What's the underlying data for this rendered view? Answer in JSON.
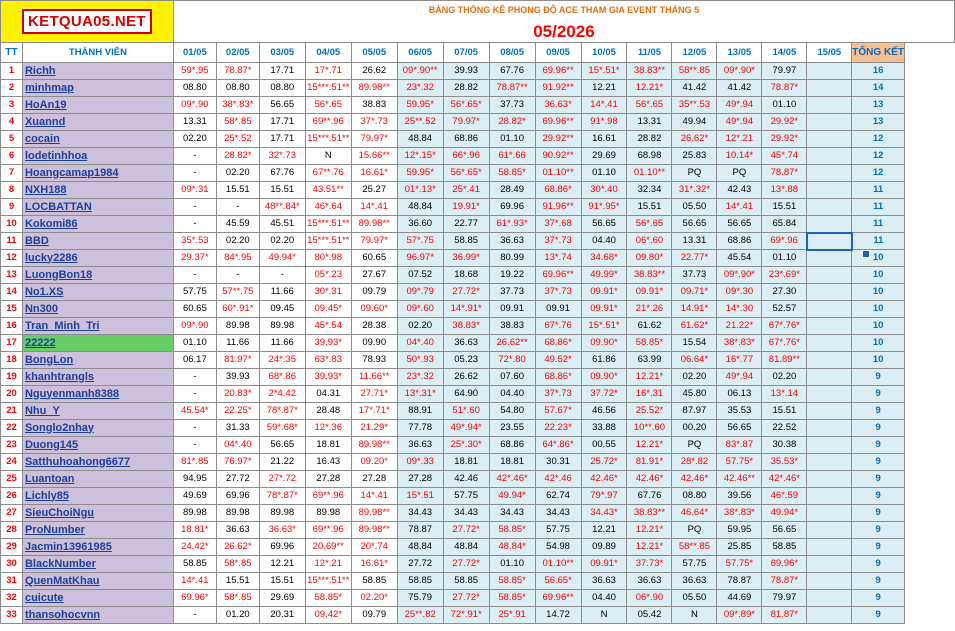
{
  "logo": "KETQUA05.NET",
  "title": "BẢNG THỐNG KÊ PHONG ĐỘ ACE THAM GIA EVENT THÁNG 5",
  "month": "05/2026",
  "headers": {
    "tt": "TT",
    "member": "THÀNH VIÊN",
    "dates": [
      "01/05",
      "02/05",
      "03/05",
      "04/05",
      "05/05",
      "06/05",
      "07/05",
      "08/05",
      "09/05",
      "10/05",
      "11/05",
      "12/05",
      "13/05",
      "14/05",
      "15/05"
    ],
    "total": "TỔNG KẾT"
  },
  "rows": [
    {
      "tt": "1",
      "name": "Richh",
      "s": [
        "59*.95",
        "78.87*",
        "17.71",
        "17*.71",
        "26.62",
        "09*.90**",
        "39.93",
        "67.76",
        "69.96**",
        "15*.51*",
        "38.83**",
        "58**.85",
        "09*.90*",
        "79.97",
        ""
      ],
      "t": "16"
    },
    {
      "tt": "2",
      "name": "minhmap",
      "s": [
        "08.80",
        "08.80",
        "08.80",
        "15***.51**",
        "89.98**",
        "23*.32",
        "28.82",
        "78.87**",
        "91.92**",
        "12.21",
        "12.21*",
        "41.42",
        "41.42",
        "78.87*",
        ""
      ],
      "t": "14"
    },
    {
      "tt": "3",
      "name": "HoAn19",
      "s": [
        "09*.90",
        "38*.83*",
        "56.65",
        "56*.65",
        "38.83",
        "59.95*",
        "56*.65*",
        "37.73",
        "36.63*",
        "14*.41",
        "56*.65",
        "35**.53",
        "49*.94",
        "01.10",
        ""
      ],
      "t": "13"
    },
    {
      "tt": "4",
      "name": "Xuannd",
      "s": [
        "13.31",
        "58*.85",
        "17.71",
        "69**.96",
        "37*.73",
        "25**.52",
        "79.97*",
        "28.82*",
        "69.96**",
        "91*.98",
        "13.31",
        "49.94",
        "49*.94",
        "29.92*",
        ""
      ],
      "t": "13"
    },
    {
      "tt": "5",
      "name": "cocain",
      "s": [
        "02.20",
        "25*.52",
        "17.71",
        "15***.51**",
        "79.97*",
        "48.84",
        "68.86",
        "01.10",
        "29.92**",
        "16.61",
        "28.82",
        "26.62*",
        "12*.21",
        "29.92*",
        ""
      ],
      "t": "12"
    },
    {
      "tt": "6",
      "name": "lodetinhhoa",
      "s": [
        "-",
        "28.82*",
        "32*.73",
        "N",
        "15.66**",
        "12*.15*",
        "66*.96",
        "61*.66",
        "90.92**",
        "29.69",
        "68.98",
        "25.83",
        "10.14*",
        "45*.74",
        ""
      ],
      "t": "12"
    },
    {
      "tt": "7",
      "name": "Hoangcamap1984",
      "s": [
        "-",
        "02.20",
        "67.76",
        "67**.76",
        "16.61*",
        "59.95*",
        "56*.65*",
        "58.85*",
        "01.10**",
        "01.10",
        "01.10**",
        "PQ",
        "PQ",
        "78.87*",
        ""
      ],
      "t": "12"
    },
    {
      "tt": "8",
      "name": "NXH188",
      "s": [
        "09*.31",
        "15.51",
        "15.51",
        "43.51**",
        "25.27",
        "01*.13*",
        "25*.41",
        "28.49",
        "68.86*",
        "30*.40",
        "32.34",
        "31*.32*",
        "42.43",
        "13*.88",
        ""
      ],
      "t": "11"
    },
    {
      "tt": "9",
      "name": "LOCBATTAN",
      "s": [
        "-",
        "-",
        "48**.84*",
        "46*.64",
        "14*.41",
        "48.84",
        "19.91*",
        "69.96",
        "91.96**",
        "91*.95*",
        "15.51",
        "05.50",
        "14*.41",
        "15.51",
        ""
      ],
      "t": "11"
    },
    {
      "tt": "10",
      "name": "Kokomi86",
      "s": [
        "-",
        "45.59",
        "45.51",
        "15***.51**",
        "89.98**",
        "36.60",
        "22.77",
        "61*.93*",
        "37*.68",
        "56.65",
        "56*.65",
        "56.65",
        "56.65",
        "65.84",
        ""
      ],
      "t": "11"
    },
    {
      "tt": "11",
      "name": "BBD",
      "s": [
        "35*.53",
        "02.20",
        "02.20",
        "15***.51**",
        "79.97*",
        "57*.75",
        "58.85",
        "36.63",
        "37*.73",
        "04.40",
        "06*.60",
        "13.31",
        "68.86",
        "69*.96",
        ""
      ],
      "t": "11"
    },
    {
      "tt": "12",
      "name": "lucky2286",
      "s": [
        "29.37*",
        "84*.95",
        "49.94*",
        "80*.98",
        "60.65",
        "96.97*",
        "36.99*",
        "80.99",
        "13*.74",
        "34.68*",
        "09.80*",
        "22.77*",
        "45.54",
        "01.10",
        ""
      ],
      "t": "10"
    },
    {
      "tt": "13",
      "name": "LuongBon18",
      "s": [
        "-",
        "-",
        "-",
        "05*.23",
        "27.67",
        "07.52",
        "18.68",
        "19.22",
        "69.96**",
        "49.99*",
        "38.83**",
        "37.73",
        "09*.90*",
        "23*.69*",
        ""
      ],
      "t": "10"
    },
    {
      "tt": "14",
      "name": "No1.XS",
      "s": [
        "57.75",
        "57**.75",
        "11.66",
        "30*.31",
        "09.79",
        "09*.79",
        "27.72*",
        "37.73",
        "37*.73",
        "09.91*",
        "09.91*",
        "09.71*",
        "09*.30",
        "27.30",
        ""
      ],
      "t": "10"
    },
    {
      "tt": "15",
      "name": "Nn300",
      "s": [
        "60.65",
        "60*.91*",
        "09.45",
        "09.45*",
        "09.60*",
        "09*.60",
        "14*.91*",
        "09.91",
        "09.91",
        "09.91*",
        "21*.26",
        "14.91*",
        "14*.30",
        "52.57",
        ""
      ],
      "t": "10"
    },
    {
      "tt": "16",
      "name": "Tran_Minh_Tri",
      "s": [
        "09*.90",
        "89.98",
        "89.98",
        "45*.54",
        "28.38",
        "02.20",
        "38.83*",
        "38.83",
        "67*.76",
        "15*.51*",
        "61.62",
        "61.62*",
        "21.22*",
        "67*.76*",
        ""
      ],
      "t": "10"
    },
    {
      "tt": "17",
      "name": "22222",
      "s": [
        "01.10",
        "11.66",
        "11.66",
        "39.93*",
        "09.90",
        "04*.40",
        "36.63",
        "26.62**",
        "68.86*",
        "09.90*",
        "58.85*",
        "15.54",
        "38*.83*",
        "67*.76*",
        ""
      ],
      "t": "10"
    },
    {
      "tt": "18",
      "name": "BongLon",
      "s": [
        "06.17",
        "81.97*",
        "24*.35",
        "63*.83",
        "78.93",
        "50*.93",
        "05.23",
        "72*.80",
        "49.52*",
        "61.86",
        "63.99",
        "06.64*",
        "16*.77",
        "81.89**",
        ""
      ],
      "t": "10"
    },
    {
      "tt": "19",
      "name": "khanhtrangls",
      "s": [
        "-",
        "39.93",
        "68*.86",
        "39.93*",
        "11.66**",
        "23*.32",
        "26.62",
        "07.60",
        "68.86*",
        "09.90*",
        "12.21*",
        "02.20",
        "49*.94",
        "02.20",
        ""
      ],
      "t": "9"
    },
    {
      "tt": "20",
      "name": "Nguyenmanh8388",
      "s": [
        "-",
        "20.83*",
        "2*4.42",
        "04.31",
        "27.71*",
        "13*.31*",
        "64.90",
        "04.40",
        "37*.73",
        "37.72*",
        "16*.31",
        "45.80",
        "06.13",
        "13*.14",
        ""
      ],
      "t": "9"
    },
    {
      "tt": "21",
      "name": "Nhu_Y",
      "s": [
        "45.54*",
        "22.25*",
        "78*.87*",
        "28.48",
        "17*.71*",
        "88.91",
        "51*.60",
        "54.80",
        "57.67*",
        "46.56",
        "25.52*",
        "87.97",
        "35.53",
        "15.51",
        ""
      ],
      "t": "9"
    },
    {
      "tt": "22",
      "name": "Songlo2nhay",
      "s": [
        "-",
        "31.33",
        "59*.68*",
        "12*.36",
        "21.29*",
        "77.78",
        "49*.94*",
        "23.55",
        "22.23*",
        "33.88",
        "10**.60",
        "00.20",
        "56.65",
        "22.52",
        ""
      ],
      "t": "9"
    },
    {
      "tt": "23",
      "name": "Duong145",
      "s": [
        "-",
        "04*.40",
        "56.65",
        "18.81",
        "89.98**",
        "36.63",
        "25*.30*",
        "68.86",
        "64*.86*",
        "00.55",
        "12.21*",
        "PQ",
        "83*.87",
        "30.38",
        ""
      ],
      "t": "9"
    },
    {
      "tt": "24",
      "name": "Satthuhoahong6677",
      "s": [
        "81*.85",
        "76.97*",
        "21.22",
        "16.43",
        "09.20*",
        "09*.33",
        "18.81",
        "18.81",
        "30.31",
        "25.72*",
        "81.91*",
        "28*.82",
        "57.75*",
        "35.53*",
        ""
      ],
      "t": "9"
    },
    {
      "tt": "25",
      "name": "Luantoan",
      "s": [
        "94.95",
        "27.72",
        "27*.72",
        "27.28",
        "27.28",
        "27.28",
        "42.46",
        "42*.46*",
        "42*.46",
        "42.46*",
        "42.46*",
        "42.46*",
        "42.46**",
        "42*.46*",
        ""
      ],
      "t": "9"
    },
    {
      "tt": "26",
      "name": "Lichly85",
      "s": [
        "49.69",
        "69.96",
        "78*.87*",
        "69**.96",
        "14*.41",
        "15*.51",
        "57.75",
        "49.94*",
        "62.74",
        "79*.97",
        "67.76",
        "08.80",
        "39.56",
        "46*.59",
        ""
      ],
      "t": "9"
    },
    {
      "tt": "27",
      "name": "SieuChoiNgu",
      "s": [
        "89.98",
        "89.98",
        "89.98",
        "89.98",
        "89.98**",
        "34.43",
        "34.43",
        "34.43",
        "34.43",
        "34.43*",
        "38.83**",
        "46.64*",
        "38*.83*",
        "49.94*",
        ""
      ],
      "t": "9"
    },
    {
      "tt": "28",
      "name": "ProNumber",
      "s": [
        "18.81*",
        "36.63",
        "36.63*",
        "69**.96",
        "89.98**",
        "78.87",
        "27.72*",
        "58.85*",
        "57.75",
        "12.21",
        "12.21*",
        "PQ",
        "59.95",
        "56.65",
        ""
      ],
      "t": "9"
    },
    {
      "tt": "29",
      "name": "Jacmin13961985",
      "s": [
        "24.42*",
        "26.62*",
        "69.96",
        "20.69**",
        "20*.74",
        "48.84",
        "48.84",
        "48.84*",
        "54.98",
        "09.89",
        "12.21*",
        "58**.85",
        "25.85",
        "58.85",
        ""
      ],
      "t": "9"
    },
    {
      "tt": "30",
      "name": "BlackNumber",
      "s": [
        "58.85",
        "58*.85",
        "12.21",
        "12*.21",
        "16.61*",
        "27.72",
        "27.72*",
        "01.10",
        "01.10**",
        "09.91*",
        "37.73*",
        "57.75",
        "57.75*",
        "69.96*",
        ""
      ],
      "t": "9"
    },
    {
      "tt": "31",
      "name": "QuenMatKhau",
      "s": [
        "14*.41",
        "15.51",
        "15.51",
        "15***.51**",
        "58.85",
        "58.85",
        "58.85",
        "58.85*",
        "56.65*",
        "36.63",
        "36.63",
        "36.63",
        "78.87",
        "78.87*",
        ""
      ],
      "t": "9"
    },
    {
      "tt": "32",
      "name": "cuicute",
      "s": [
        "69.96*",
        "58*.85",
        "29.69",
        "58.85*",
        "02.20*",
        "75.79",
        "27.72*",
        "58.85*",
        "69.96**",
        "04.40",
        "06*.90",
        "05.50",
        "44.69",
        "79.97",
        ""
      ],
      "t": "9"
    },
    {
      "tt": "33",
      "name": "thansohocvnn",
      "s": [
        "-",
        "01.20",
        "20.31",
        "09.42*",
        "09.79",
        "25**.82",
        "72*.91*",
        "25*.91",
        "14.72",
        "N",
        "05.42",
        "N",
        "09*.89*",
        "81.87*",
        ""
      ],
      "t": "9"
    }
  ]
}
